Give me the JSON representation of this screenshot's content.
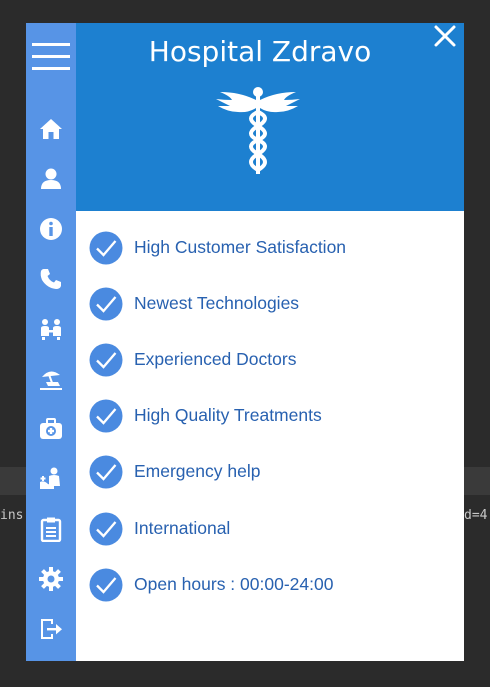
{
  "background": {
    "left_text": "ins",
    "right_text": "d=4"
  },
  "window": {
    "title": "Hospital Zdravo",
    "logo": "caduceus-icon",
    "close_icon": "close-icon"
  },
  "sidebar": {
    "menu_icon": "hamburger-menu-icon",
    "items": [
      {
        "icon": "home-icon"
      },
      {
        "icon": "user-icon"
      },
      {
        "icon": "info-icon"
      },
      {
        "icon": "phone-icon"
      },
      {
        "icon": "group-meeting-icon"
      },
      {
        "icon": "beach-icon"
      },
      {
        "icon": "medical-kit-icon"
      },
      {
        "icon": "doctor-care-icon"
      },
      {
        "icon": "clipboard-icon"
      },
      {
        "icon": "settings-icon"
      },
      {
        "icon": "logout-icon"
      }
    ]
  },
  "features": [
    {
      "label": "High Customer Satisfaction"
    },
    {
      "label": "Newest Technologies"
    },
    {
      "label": "Experienced Doctors"
    },
    {
      "label": "High Quality Treatments"
    },
    {
      "label": "Emergency help"
    },
    {
      "label": "International"
    },
    {
      "label": "Open hours : 00:00-24:00"
    }
  ],
  "colors": {
    "sidebar": "#5794e6",
    "header": "#1d80d0",
    "check": "#4a8ae0",
    "feature_text": "#2861b0"
  }
}
